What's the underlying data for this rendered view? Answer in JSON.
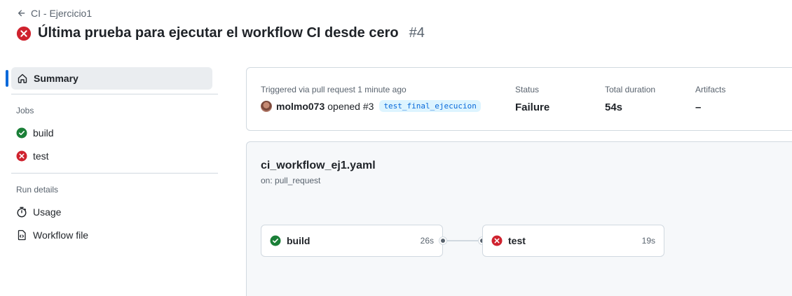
{
  "breadcrumb": {
    "label": "CI - Ejercicio1"
  },
  "header": {
    "title": "Última prueba para ejecutar el workflow CI desde cero",
    "run_number": "#4"
  },
  "sidebar": {
    "summary_label": "Summary",
    "jobs_heading": "Jobs",
    "jobs": [
      {
        "label": "build",
        "status": "success"
      },
      {
        "label": "test",
        "status": "failure"
      }
    ],
    "run_details_heading": "Run details",
    "details": [
      {
        "label": "Usage",
        "icon": "stopwatch-icon"
      },
      {
        "label": "Workflow file",
        "icon": "file-code-icon"
      }
    ]
  },
  "summary": {
    "trigger_label": "Triggered via pull request 1 minute ago",
    "trigger_user": "molmo073",
    "trigger_action": "opened #3",
    "branch": "test_final_ejecucion",
    "status_label": "Status",
    "status_value": "Failure",
    "duration_label": "Total duration",
    "duration_value": "54s",
    "artifacts_label": "Artifacts",
    "artifacts_value": "–"
  },
  "workflow": {
    "file_name": "ci_workflow_ej1.yaml",
    "trigger": "on: pull_request",
    "jobs": [
      {
        "name": "build",
        "duration": "26s",
        "status": "success"
      },
      {
        "name": "test",
        "duration": "19s",
        "status": "failure"
      }
    ]
  },
  "colors": {
    "success": "#1a7f37",
    "failure": "#cf222e",
    "accent": "#0969da"
  }
}
